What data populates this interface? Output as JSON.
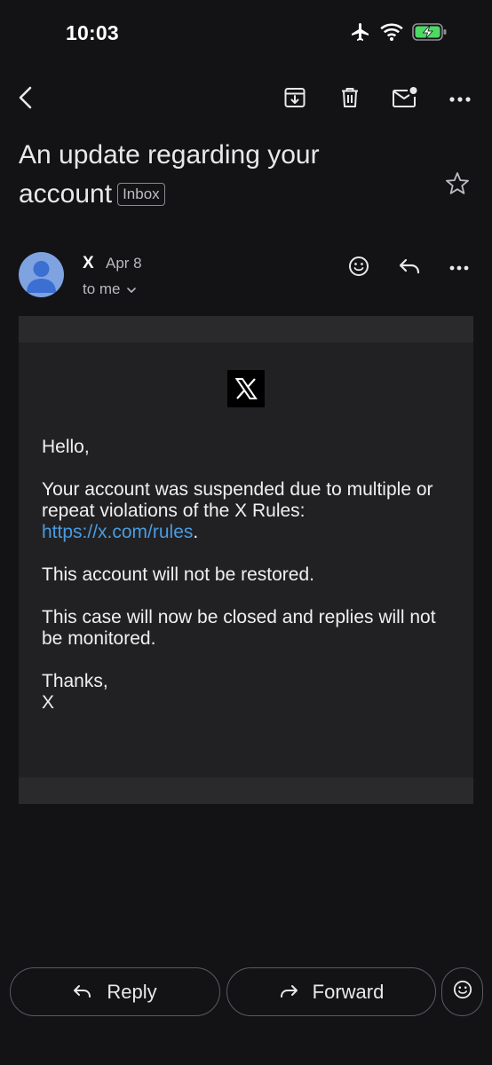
{
  "status_bar": {
    "time": "10:03",
    "icons": [
      "airplane-icon",
      "wifi-icon",
      "battery-charging-icon"
    ]
  },
  "toolbar": {
    "back_icon": "back-arrow-icon",
    "actions": [
      "archive-icon",
      "delete-icon",
      "mark-unread-icon",
      "more-icon"
    ]
  },
  "email": {
    "subject": "An update regarding your account",
    "label": "Inbox",
    "sender_name": "X",
    "date": "Apr 8",
    "recipient": "to me",
    "body": {
      "greeting": "Hello,",
      "line1": "Your account was suspended due to multiple or repeat violations of the X Rules:",
      "link": "https://x.com/rules",
      "link_suffix": ".",
      "line2": "This account will not be restored.",
      "line3": "This case will now be closed and replies will not be monitored.",
      "signoff": "Thanks,",
      "signature": "X"
    }
  },
  "actions": {
    "reply_label": "Reply",
    "forward_label": "Forward"
  },
  "colors": {
    "background": "#131316",
    "card": "#212124",
    "link": "#4a9be0",
    "avatar": "#7fa3e0",
    "battery": "#4cd964"
  }
}
